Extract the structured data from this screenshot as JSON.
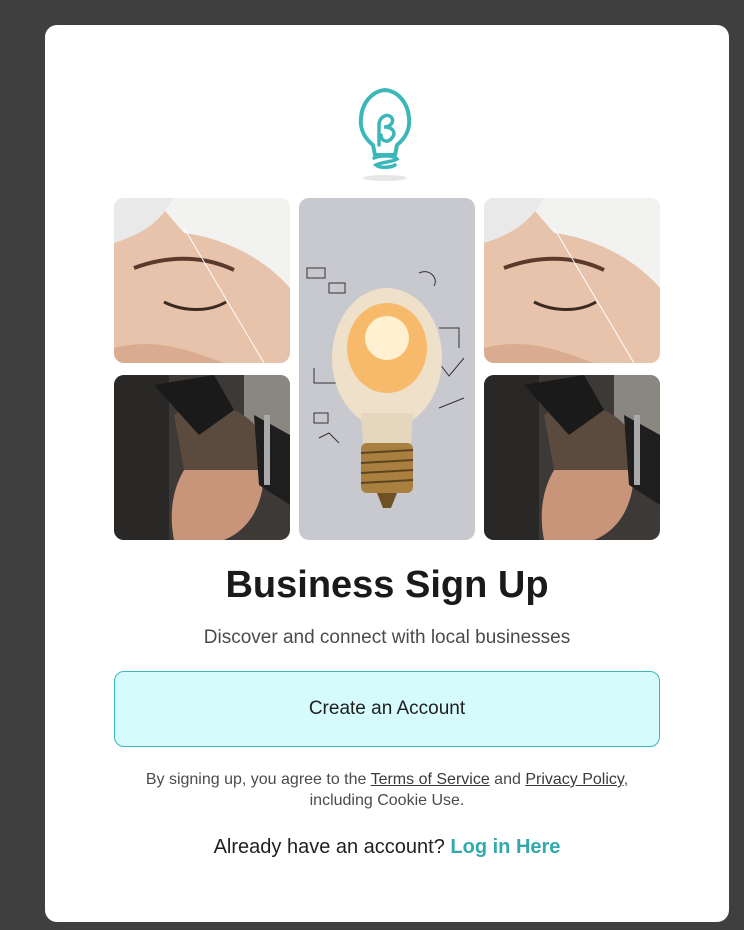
{
  "brand": {
    "logo_icon": "lightbulb-logo-icon",
    "accent_color": "#3bb7ba"
  },
  "gallery": {
    "images": [
      {
        "icon": "eyebrow-threading-photo"
      },
      {
        "icon": "lightbulb-ideas-photo"
      },
      {
        "icon": "eyebrow-threading-photo"
      },
      {
        "icon": "barber-haircut-photo"
      },
      {
        "icon": "barber-haircut-photo"
      }
    ]
  },
  "signup": {
    "title": "Business Sign Up",
    "subtitle": "Discover and connect with local businesses",
    "create_button_label": "Create an Account",
    "terms_prefix": "By signing up, you agree to the ",
    "terms_link": "Terms of Service",
    "terms_and": " and ",
    "privacy_link": "Privacy Policy",
    "terms_suffix": ", including Cookie Use.",
    "login_prompt": "Already have an account? ",
    "login_link": "Log in Here"
  },
  "colors": {
    "page_background": "#3f3f3f",
    "card_background": "#ffffff",
    "button_background": "#d6fbfc",
    "link_teal": "#32a9ad"
  }
}
